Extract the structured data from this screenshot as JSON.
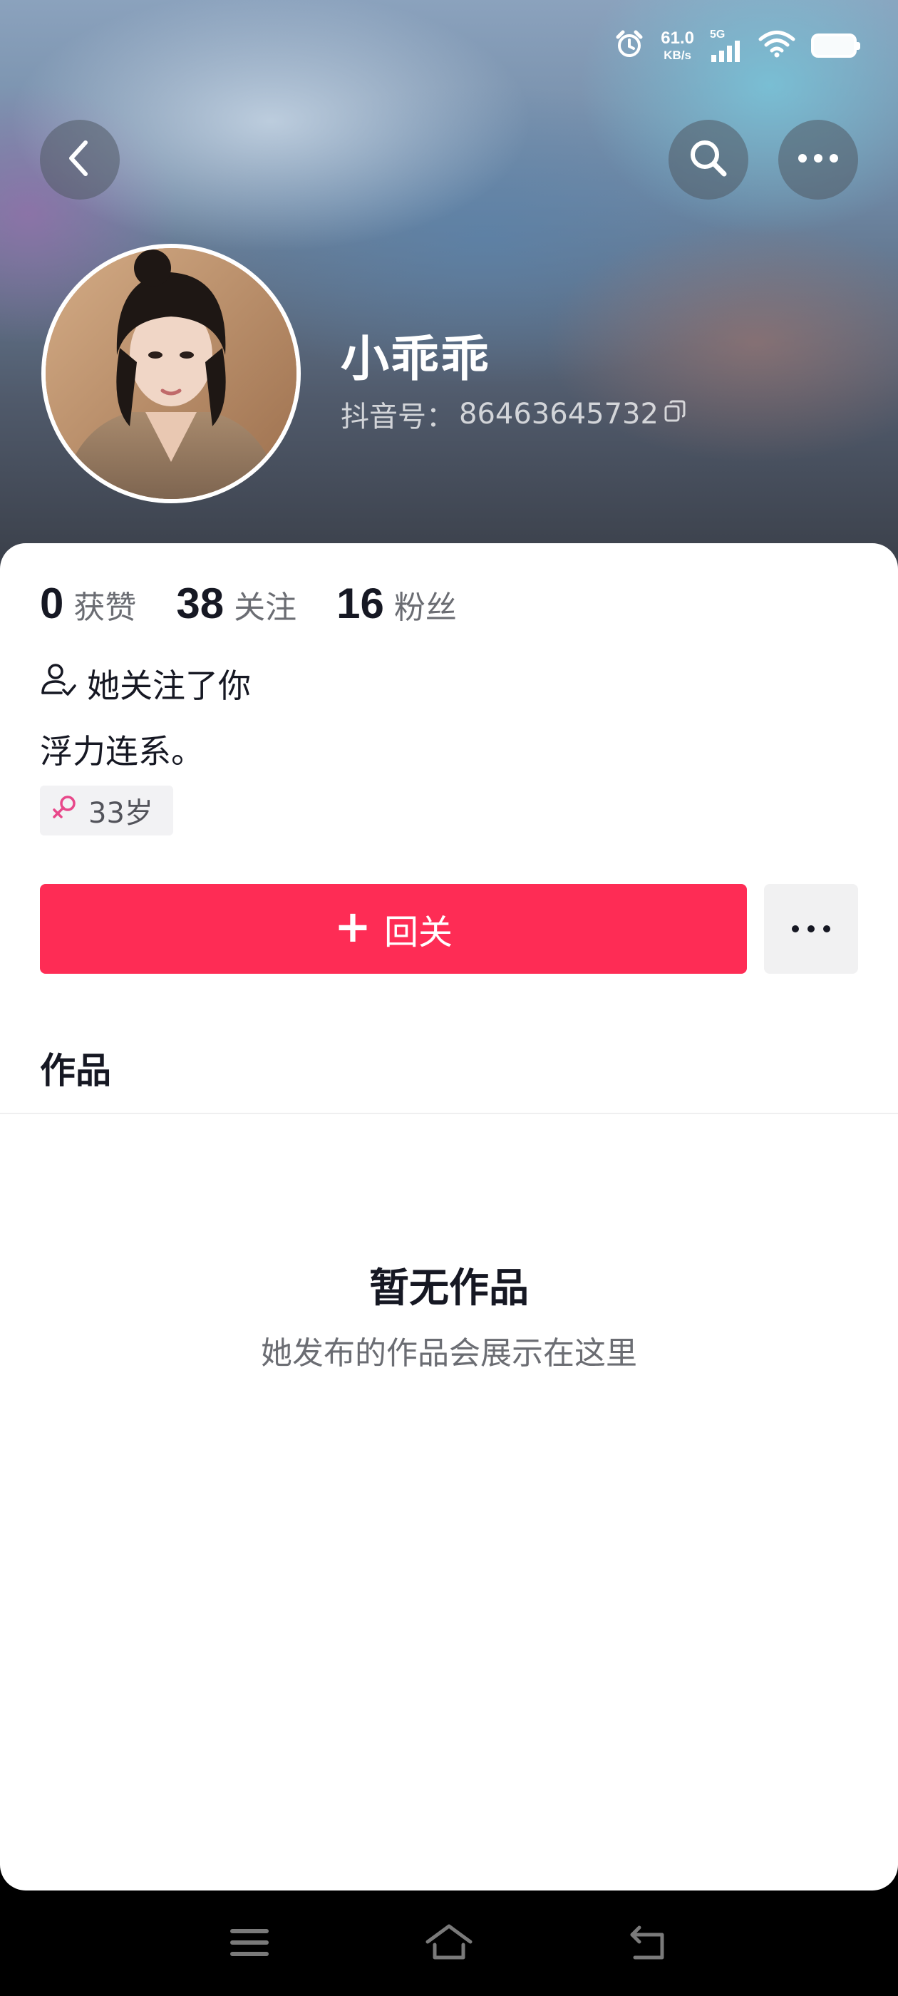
{
  "status_bar": {
    "net_speed_value": "61.0",
    "net_speed_unit": "KB/s",
    "network": "5G",
    "icons": [
      "alarm-icon",
      "signal-icon",
      "wifi-icon",
      "battery-icon"
    ]
  },
  "header": {
    "back_icon": "chevron-left-icon",
    "search_icon": "search-icon",
    "more_icon": "more-horizontal-icon"
  },
  "profile": {
    "name": "小乖乖",
    "id_label": "抖音号：",
    "id_value": "86463645732",
    "copy_icon": "copy-icon"
  },
  "stats": [
    {
      "num": "0",
      "label": "获赞"
    },
    {
      "num": "38",
      "label": "关注"
    },
    {
      "num": "16",
      "label": "粉丝"
    }
  ],
  "follow_note": "她关注了你",
  "bio": "浮力连系。",
  "age_tag": "33岁",
  "actions": {
    "follow_back_plus": "+",
    "follow_back_label": "回关"
  },
  "tabs": {
    "works": "作品"
  },
  "empty_state": {
    "title": "暂无作品",
    "subtitle": "她发布的作品会展示在这里"
  },
  "colors": {
    "accent": "#fe2c55",
    "text_primary": "#161823",
    "text_secondary": "#6b6d73",
    "gender_pink": "#e8488a"
  }
}
